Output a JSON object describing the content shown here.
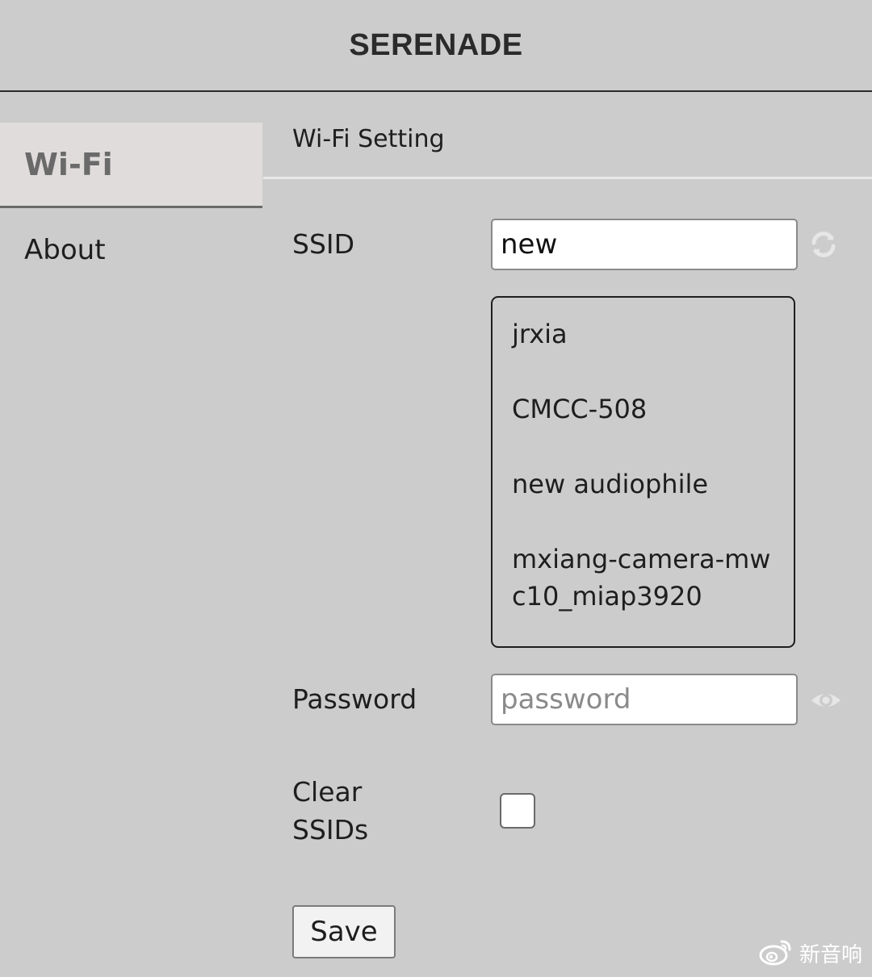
{
  "header": {
    "title": "SERENADE"
  },
  "sidebar": {
    "items": [
      {
        "label": "Wi-Fi",
        "active": true
      },
      {
        "label": "About",
        "active": false
      }
    ]
  },
  "wifi": {
    "section_title": "Wi-Fi Setting",
    "ssid_label": "SSID",
    "ssid_value": "new",
    "refresh_icon": "refresh-icon",
    "ssid_options": [
      "jrxia",
      "CMCC-508",
      "new audiophile",
      "mxiang-camera-mwc10_miap3920"
    ],
    "password_label": "Password",
    "password_placeholder": "password",
    "password_value": "",
    "show_password_icon": "eye-icon",
    "clear_label_line1": "Clear",
    "clear_label_line2": "SSIDs",
    "clear_checked": false,
    "save_label": "Save"
  },
  "watermark": {
    "text": "新音响"
  },
  "colors": {
    "background": "#cccccc",
    "sidebar_active": "#e0dcdc",
    "sidebar_active_text": "#6a6a6a",
    "text": "#1e1e1e"
  }
}
